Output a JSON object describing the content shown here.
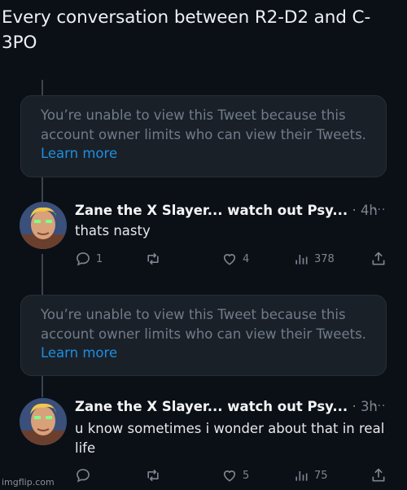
{
  "meme": {
    "caption": "Every conversation between R2-D2 and C-3PO",
    "watermark": "imgflip.com"
  },
  "notices": [
    {
      "text": "You’re unable to view this Tweet because this account owner limits who can view their Tweets.",
      "link": "Learn more"
    },
    {
      "text": "You’re unable to view this Tweet because this account owner limits who can view their Tweets.",
      "link": "Learn more"
    }
  ],
  "tweets": [
    {
      "author": "Zane the X Slayer... watch out Psy...",
      "separator": "·",
      "time": "4h",
      "more": "···",
      "text": "thats nasty",
      "reply_count": "1",
      "retweet_count": "",
      "like_count": "4",
      "views_count": "378"
    },
    {
      "author": "Zane the X Slayer... watch out Psy...",
      "separator": "·",
      "time": "3h",
      "more": "···",
      "text": "u know sometimes i wonder about that in real life",
      "reply_count": "",
      "retweet_count": "",
      "like_count": "5",
      "views_count": "75"
    }
  ],
  "colors": {
    "background": "#0b0f16",
    "link": "#1d8fe0",
    "muted": "#7b8590"
  }
}
